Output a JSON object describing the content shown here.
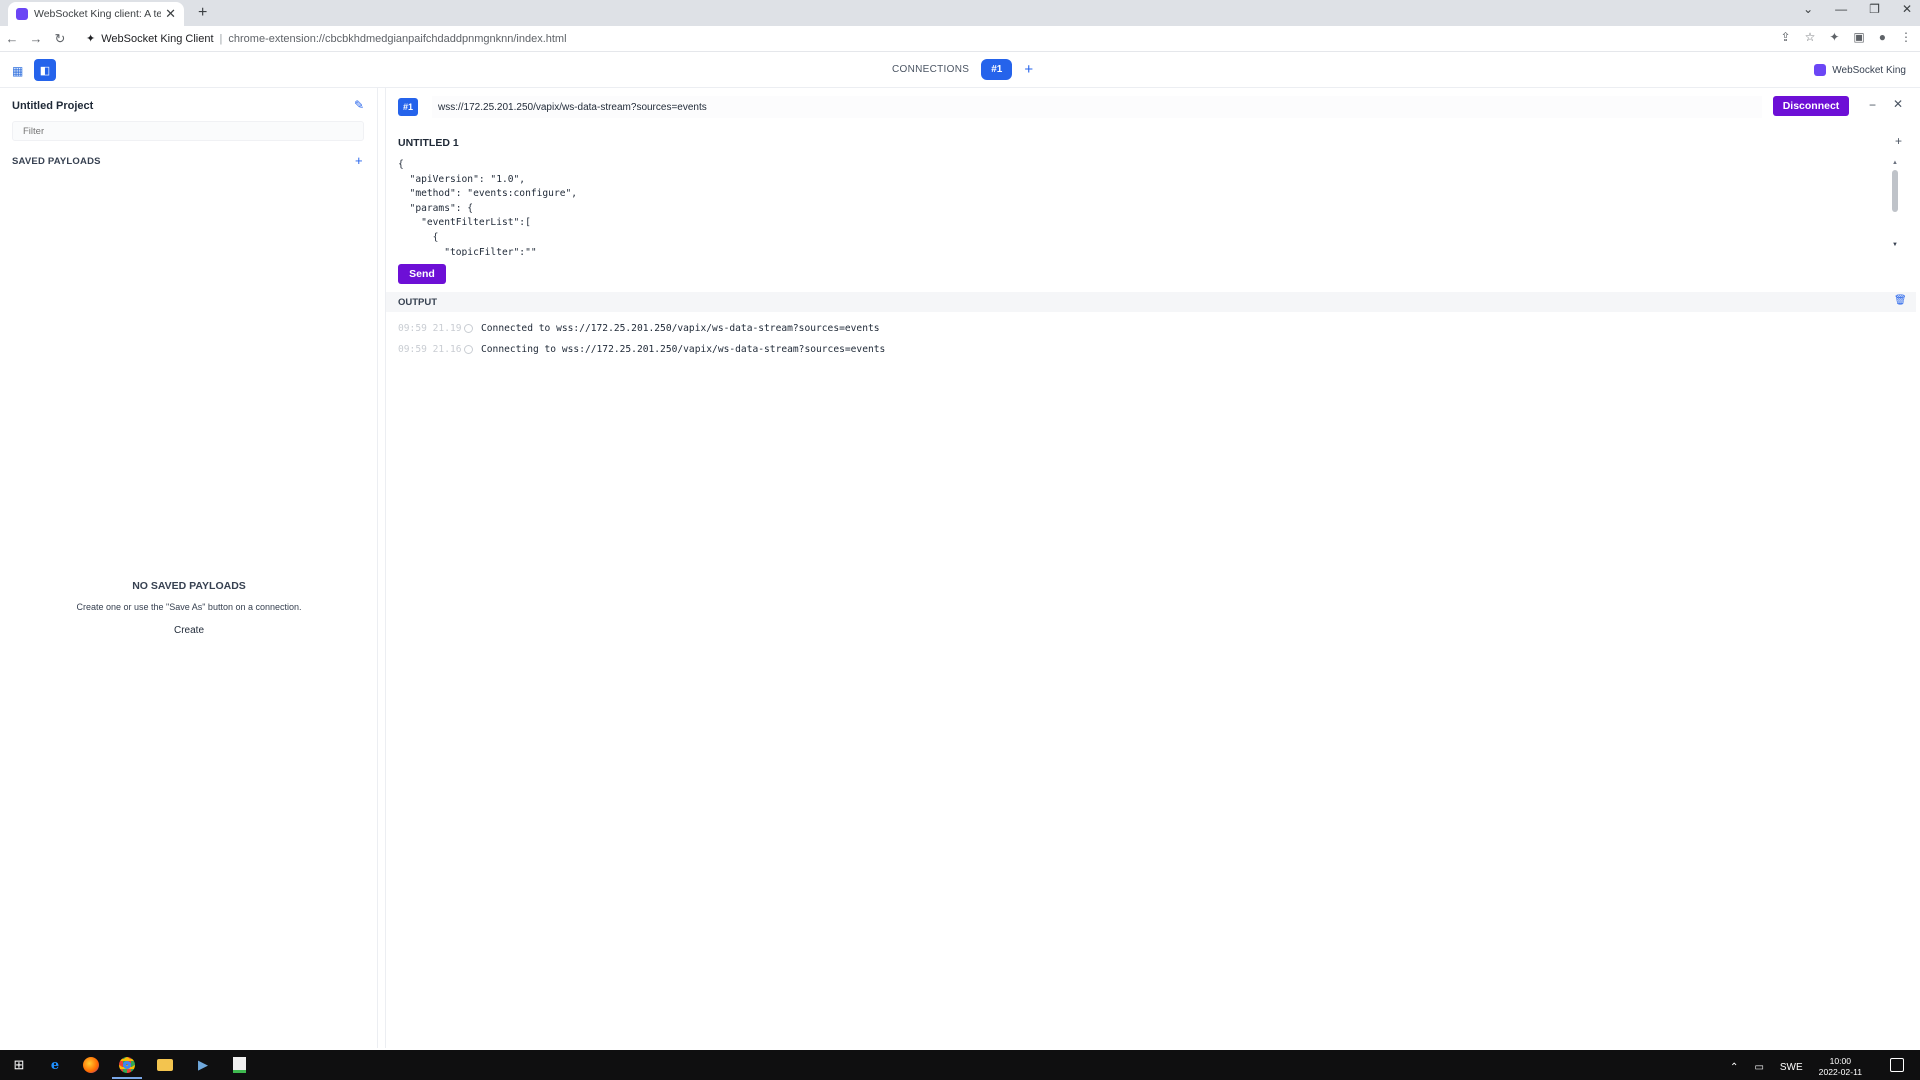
{
  "browser": {
    "tab_title": "WebSocket King client: A testing",
    "site_label": "WebSocket King Client",
    "url": "chrome-extension://cbcbkhdmedgianpaifchdaddpnmgnknn/index.html"
  },
  "header": {
    "connections_label": "CONNECTIONS",
    "active_connection": "#1",
    "brand": "WebSocket King"
  },
  "sidebar": {
    "project_name": "Untitled Project",
    "filter_placeholder": "Filter",
    "saved_payloads_label": "SAVED PAYLOADS",
    "empty_title": "NO SAVED PAYLOADS",
    "empty_text": "Create one or use the \"Save As\" button on a connection.",
    "create_link": "Create"
  },
  "connection": {
    "badge": "#1",
    "url": "wss://172.25.201.250/vapix/ws-data-stream?sources=events",
    "disconnect_label": "Disconnect",
    "message_title": "UNTITLED 1",
    "payload": "{\n  \"apiVersion\": \"1.0\",\n  \"method\": \"events:configure\",\n  \"params\": {\n    \"eventFilterList\":[\n      {\n        \"topicFilter\":\"\"",
    "send_label": "Send"
  },
  "output": {
    "label": "OUTPUT",
    "log": [
      {
        "time": "09:59 21.19",
        "message": "Connected to wss://172.25.201.250/vapix/ws-data-stream?sources=events"
      },
      {
        "time": "09:59 21.16",
        "message": "Connecting to wss://172.25.201.250/vapix/ws-data-stream?sources=events"
      }
    ]
  },
  "taskbar": {
    "language": "SWE",
    "time": "10:00",
    "date": "2022-02-11"
  },
  "colors": {
    "accent_blue": "#2563eb",
    "action_purple": "#6d0fd6"
  }
}
